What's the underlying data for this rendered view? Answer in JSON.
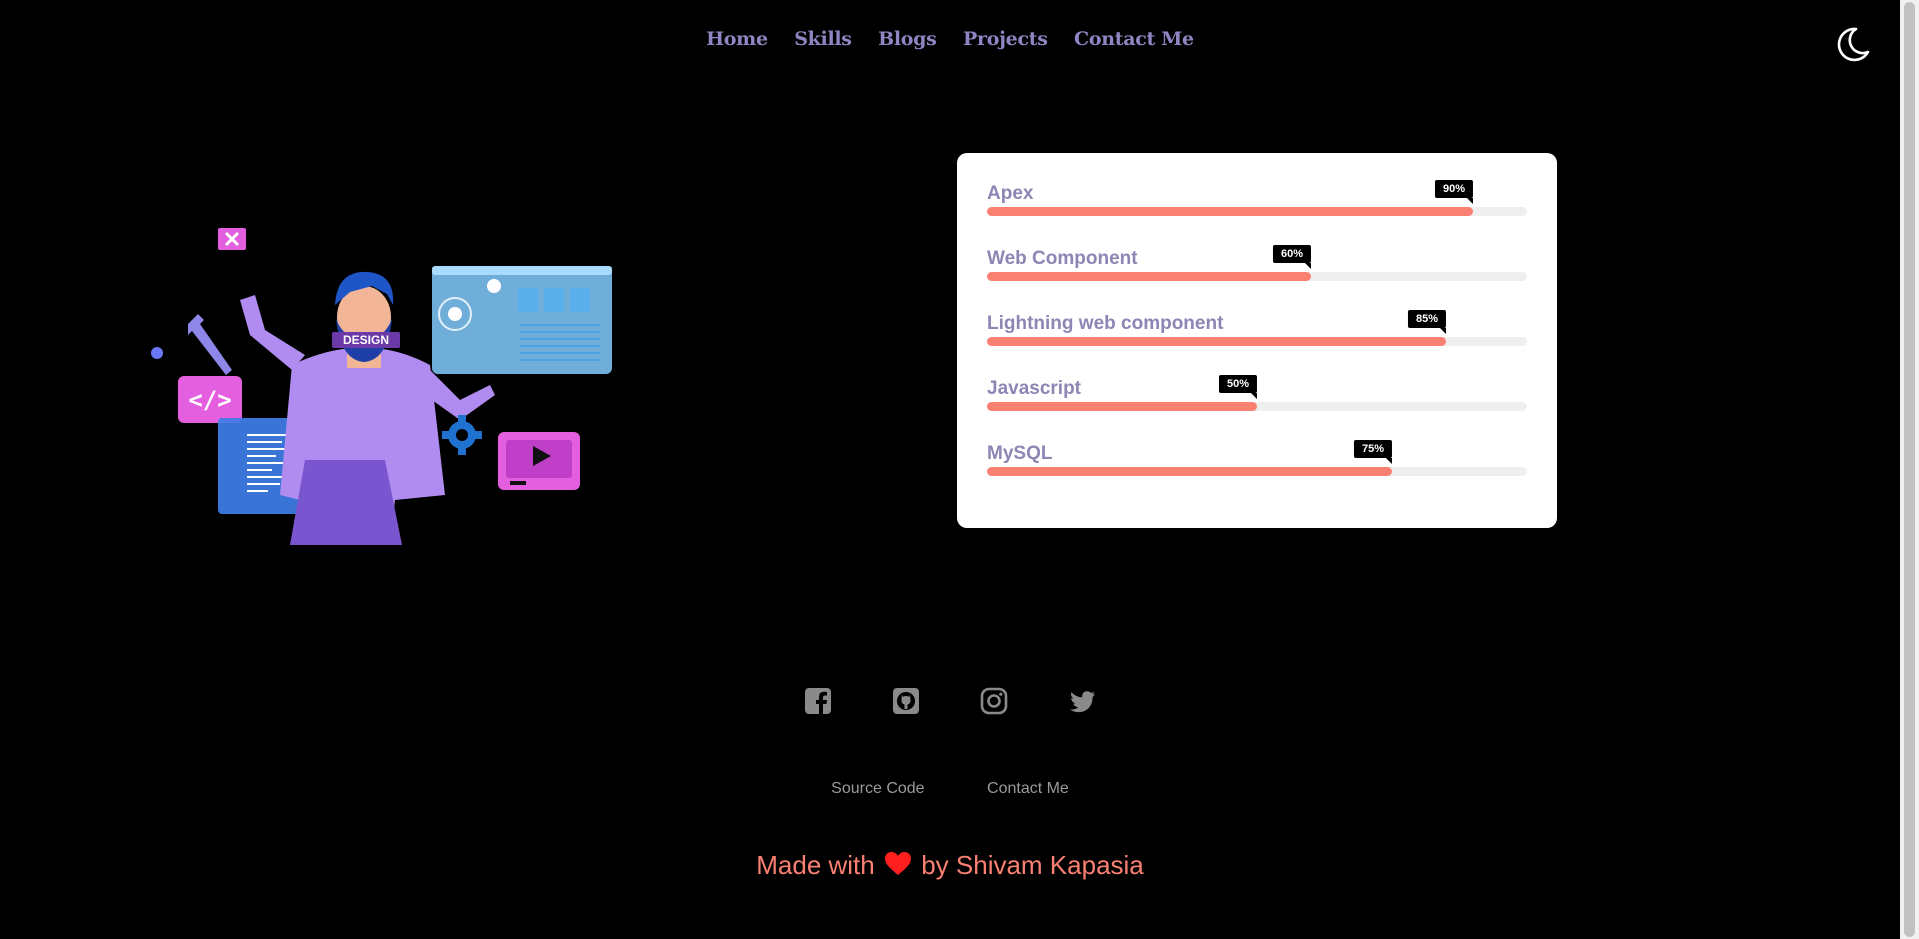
{
  "nav": {
    "items": [
      {
        "label": "Home"
      },
      {
        "label": "Skills"
      },
      {
        "label": "Blogs"
      },
      {
        "label": "Projects"
      },
      {
        "label": "Contact Me"
      }
    ]
  },
  "theme_toggle": {
    "icon": "moon-icon"
  },
  "illustration": {
    "icon": "developer-illustration",
    "badge_text": "DESIGN"
  },
  "skills": [
    {
      "name": "Apex",
      "percent": 90,
      "percent_label": "90%"
    },
    {
      "name": "Web Component",
      "percent": 60,
      "percent_label": "60%"
    },
    {
      "name": "Lightning web component",
      "percent": 85,
      "percent_label": "85%"
    },
    {
      "name": "Javascript",
      "percent": 50,
      "percent_label": "50%"
    },
    {
      "name": "MySQL",
      "percent": 75,
      "percent_label": "75%"
    }
  ],
  "social": [
    {
      "icon": "facebook-icon"
    },
    {
      "icon": "github-icon"
    },
    {
      "icon": "instagram-icon"
    },
    {
      "icon": "twitter-icon"
    }
  ],
  "footer": {
    "links": [
      {
        "label": "Source Code"
      },
      {
        "label": "Contact Me"
      }
    ],
    "made_with_prefix": "Made with",
    "made_with_suffix": "by Shivam Kapasia",
    "heart_icon": "heart-icon"
  },
  "colors": {
    "background": "#000000",
    "nav_text": "#8f85c2",
    "skill_fill": "#fa8072",
    "skill_name": "#8e85b5",
    "footer_accent": "#fa8072",
    "heart": "#ff1f1f"
  }
}
